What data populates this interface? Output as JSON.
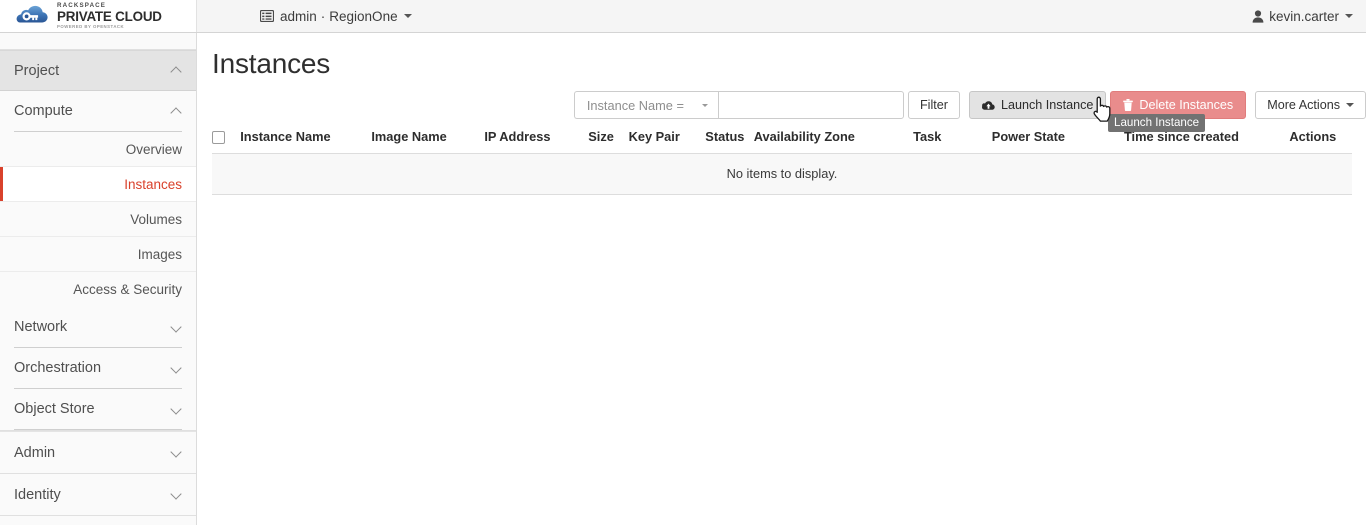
{
  "brand": {
    "line1": "RACKSPACE",
    "line2": "PRIVATE CLOUD",
    "line3": "POWERED BY OPENSTACK",
    "logo_icon": "cloud-key-icon"
  },
  "topbar": {
    "project_icon": "grid-list-icon",
    "project": "admin",
    "separator": "·",
    "region": "RegionOne",
    "user_icon": "user-icon",
    "username": "kevin.carter"
  },
  "sidebar": {
    "sections": [
      {
        "label": "Project",
        "type": "panel",
        "expanded": true,
        "chevron": "chevron-up-icon",
        "groups": [
          {
            "label": "Compute",
            "expanded": true,
            "chevron": "chevron-up-icon",
            "items": [
              {
                "label": "Overview",
                "active": false
              },
              {
                "label": "Instances",
                "active": true
              },
              {
                "label": "Volumes",
                "active": false
              },
              {
                "label": "Images",
                "active": false
              },
              {
                "label": "Access & Security",
                "active": false
              }
            ]
          },
          {
            "label": "Network",
            "expanded": false,
            "chevron": "chevron-down-icon",
            "items": []
          },
          {
            "label": "Orchestration",
            "expanded": false,
            "chevron": "chevron-down-icon",
            "items": []
          },
          {
            "label": "Object Store",
            "expanded": false,
            "chevron": "chevron-down-icon",
            "items": []
          }
        ]
      },
      {
        "label": "Admin",
        "type": "panel",
        "expanded": false,
        "chevron": "chevron-down-icon",
        "groups": []
      },
      {
        "label": "Identity",
        "type": "panel",
        "expanded": false,
        "chevron": "chevron-down-icon",
        "groups": []
      }
    ]
  },
  "main": {
    "page_title": "Instances",
    "toolbar": {
      "filter_select_label": "Instance Name =",
      "filter_select_caret": "caret-down-icon",
      "filter_input_value": "",
      "filter_input_placeholder": "",
      "filter_button": "Filter",
      "launch_button": "Launch Instance",
      "launch_icon": "cloud-upload-icon",
      "delete_button": "Delete Instances",
      "delete_icon": "trash-icon",
      "more_button": "More Actions",
      "more_caret": "caret-down-icon"
    },
    "table": {
      "select_all_checkbox": "unchecked",
      "columns": [
        "Instance Name",
        "Image Name",
        "IP Address",
        "Size",
        "Key Pair",
        "Status",
        "Availability Zone",
        "Task",
        "Power State",
        "Time since created",
        "Actions"
      ],
      "rows": [],
      "empty_message": "No items to display."
    }
  },
  "tooltip": {
    "text": "Launch Instance"
  },
  "colors": {
    "accent_red": "#d9412b",
    "delete_btn": "#e98c8c",
    "navbar_bg": "#f5f5f5",
    "sidebar_bg": "#fafafa",
    "panel_head_bg": "#e4e4e4",
    "tooltip_bg": "#727272"
  }
}
